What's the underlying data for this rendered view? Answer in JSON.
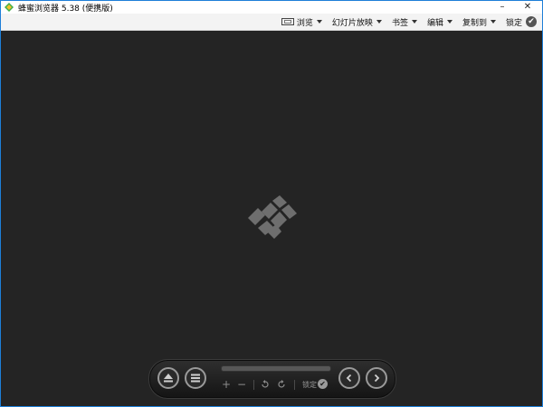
{
  "window": {
    "title": "蜂蜜浏览器 5.38 (便携版)",
    "minimize_label": "–",
    "close_label": "✕",
    "border_color": "#1e7fd8"
  },
  "menubar": {
    "items": [
      {
        "label": "浏览",
        "icon": "view-mode-icon",
        "has_dropdown": true
      },
      {
        "label": "幻灯片放映",
        "has_dropdown": true
      },
      {
        "label": "书签",
        "has_dropdown": true
      },
      {
        "label": "编辑",
        "has_dropdown": true
      },
      {
        "label": "复制到",
        "has_dropdown": true
      },
      {
        "label": "锁定",
        "icon": "check-circle-icon",
        "has_dropdown": false
      }
    ]
  },
  "viewer": {
    "background": "#242424",
    "placeholder_icon": "diamond-logo-icon"
  },
  "toolbar": {
    "eject_icon": "eject-icon",
    "menu_icon": "menu-list-icon",
    "zoom_in_label": "+",
    "zoom_out_label": "−",
    "rotate_left_icon": "rotate-left-icon",
    "rotate_right_icon": "rotate-right-icon",
    "lock_label": "锁定",
    "lock_check": "✔",
    "prev_icon": "chevron-left-icon",
    "next_icon": "chevron-right-icon"
  },
  "menu_lock_check": "✔"
}
